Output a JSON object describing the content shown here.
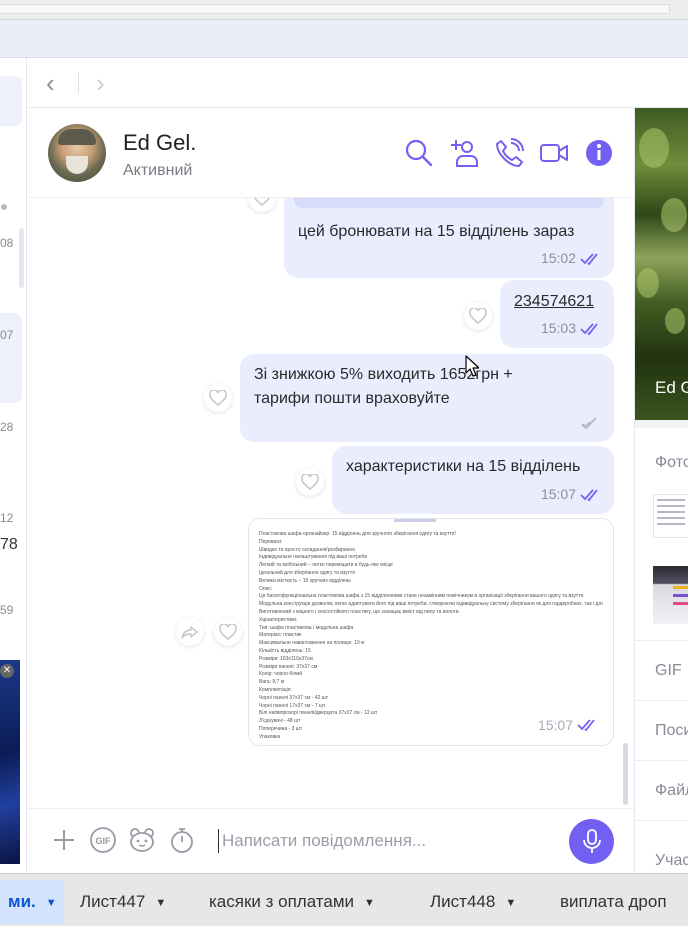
{
  "contact": {
    "name": "Ed Gel.",
    "status": "Активний"
  },
  "header_icons": [
    "search-icon",
    "add-contact-icon",
    "phone-icon",
    "video-icon",
    "info-icon"
  ],
  "left_list": {
    "numbers": [
      "08",
      "07",
      "28",
      "12",
      "78",
      "59"
    ]
  },
  "messages": [
    {
      "text": "цей бронювати на 15 відділень зараз",
      "time": "15:02",
      "read": true
    },
    {
      "text": "234574621",
      "time": "15:03",
      "read": true,
      "is_link": true
    },
    {
      "text_line1": "Зі знижкою 5% виходить 1652грн +",
      "text_line2": "тарифи пошти враховуйте",
      "delivered_icon": "sent-check-icon"
    },
    {
      "text": "характеристики на 15 відділень",
      "time": "15:07",
      "read": true
    }
  ],
  "doc_message": {
    "time": "15:07",
    "lines": [
      "Пластикова шафа-органайзер: 15 відділень для зручного зберігання одягу та взуття!",
      "Переваги:",
      "Швидко та просто складання/розбирання",
      "Індивідуальне налаштування під ваші потреби",
      "Легкий та мобільний – легко переміщати в будь-яке місце",
      "Ідеальний для зберігання одягу та взуття",
      "Велика місткість – 15 зручних відділень",
      "Опис:",
      "Ця багатофункціональна пластикова шафа з 15 відділеннями стане незамінним помічником в організації зберігання вашого одягу та взуття.",
      "Модульна конструкція дозволяє легко адаптувати його під ваші потреби, створюючи індивідуальну систему зберігання як для гардеробних, так і для дрібних речей.",
      "Виготовлений з міцного і зносостійкого пластику, що захищає вміст від пилу та вологи.",
      "Характеристики:",
      "Тип: шафа пластикова / модульна шафа",
      "Матеріал: пластик",
      "Максимальне навантаження на полицю: 10 кг",
      "Кількість відділень: 15",
      "Розміри: 163х110х37см",
      "Розміри панелі: 37х37 см",
      "Колір: чорно-білий",
      "Вага: 9,7 кг",
      "Комплектація:",
      "Чорні панелі 37х37 см - 42 шт",
      "Чорні панелі 17х37 см - 7 шт.",
      "Білі напівпрозорі панелі/дверцята 37х37 см - 12 шт",
      "З'єднувачі - 48 шт",
      "Поперечина - 3 шт",
      "Упаковка"
    ]
  },
  "input": {
    "placeholder": "Написати повідомлення..."
  },
  "right_panel": {
    "name": "Ed G",
    "sections": [
      "Фото",
      "GIF",
      "Поси",
      "Файл",
      "Учас"
    ]
  },
  "sheet_tabs": [
    {
      "label": "ми.",
      "active": true
    },
    {
      "label": "Лист447",
      "active": false
    },
    {
      "label": "касяки з оплатами",
      "active": false
    },
    {
      "label": "Лист448",
      "active": false
    },
    {
      "label": "виплата дроп",
      "active": false
    }
  ],
  "colors": {
    "accent": "#7360f2",
    "bubble": "#e9edfd",
    "link": "#3b8fd6",
    "sheet_active_bg": "#d3e3fd",
    "sheet_active_text": "#0b57d0"
  }
}
